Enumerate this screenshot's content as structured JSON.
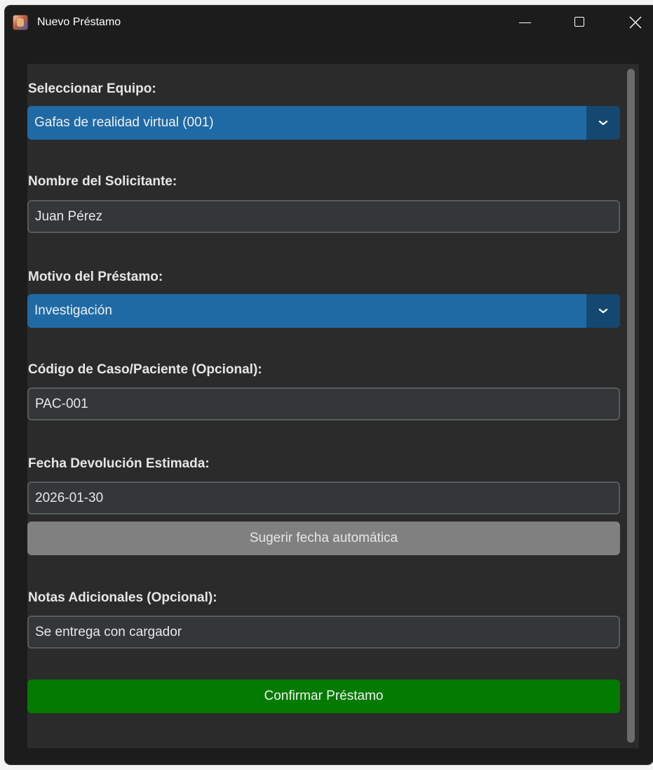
{
  "window": {
    "title": "Nuevo Préstamo",
    "icon": "app-icon",
    "controls": [
      "minimize-icon",
      "maximize-icon",
      "close-icon"
    ]
  },
  "form": {
    "equipo": {
      "label": "Seleccionar Equipo:",
      "selected": "Gafas de realidad virtual (001)"
    },
    "solicitante": {
      "label": "Nombre del Solicitante:",
      "value": "Juan Pérez"
    },
    "motivo": {
      "label": "Motivo del Préstamo:",
      "selected": "Investigación"
    },
    "codigo": {
      "label": "Código de Caso/Paciente (Opcional):",
      "value": "PAC-001"
    },
    "fecha": {
      "label": "Fecha Devolución Estimada:",
      "value": "2026-01-30",
      "suggest_button": "Sugerir fecha automática"
    },
    "notas": {
      "label": "Notas Adicionales (Opcional):",
      "value": "Se entrega con cargador"
    },
    "confirm_button": "Confirmar Préstamo"
  },
  "colors": {
    "window_bg": "#1c1c1c",
    "panel_bg": "#2b2b2b",
    "combo_bg": "#1f6aa5",
    "combo_arrow_bg": "#144870",
    "entry_bg": "#343638",
    "entry_border": "#565b5e",
    "suggest_button_bg": "#808080",
    "confirm_button_bg": "#037a00"
  }
}
